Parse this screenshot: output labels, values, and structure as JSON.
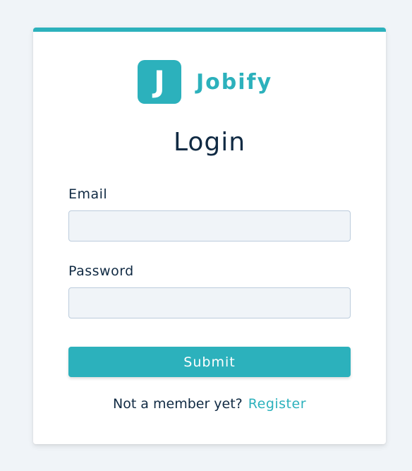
{
  "brand": {
    "logo_letter": "J",
    "name": "Jobify",
    "accent_color": "#2cb1bc"
  },
  "form": {
    "title": "Login",
    "email_label": "Email",
    "email_value": "",
    "password_label": "Password",
    "password_value": "",
    "submit_label": "Submit"
  },
  "footer": {
    "prompt": "Not a member yet?",
    "register_link": "Register"
  }
}
